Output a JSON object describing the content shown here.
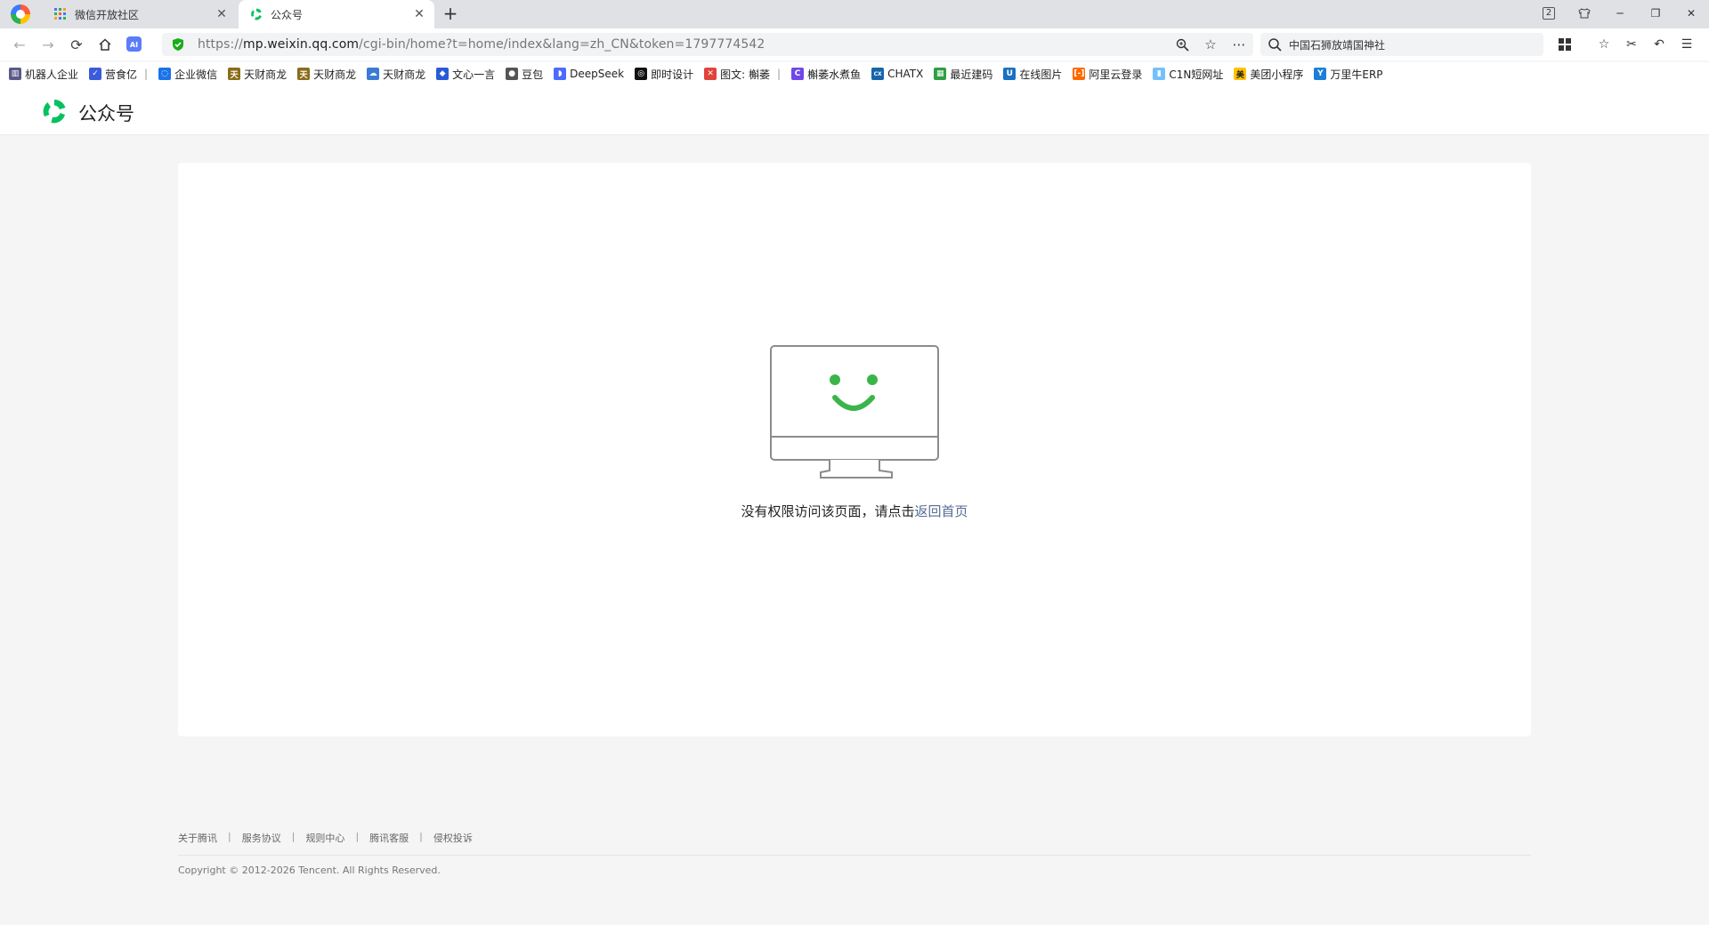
{
  "tabs": [
    {
      "title": "微信开放社区",
      "active": false
    },
    {
      "title": "公众号",
      "active": true
    }
  ],
  "window": {
    "tab_count_badge": "2"
  },
  "address_bar": {
    "scheme": "https://",
    "host": "mp.weixin.qq.com",
    "path": "/cgi-bin/home?t=home/index&lang=zh_CN&token=1797774542"
  },
  "search_box": {
    "value": "中国石狮放靖国神社"
  },
  "bookmarks": [
    {
      "label": "机器人企业",
      "icon": "robot-icon",
      "color": "#5a5a8a"
    },
    {
      "label": "营食亿",
      "icon": "shield-bookmark-icon",
      "color": "#3b5bdb",
      "separator": true
    },
    {
      "label": "企业微信",
      "icon": "wework-icon",
      "color": "#1a73e8"
    },
    {
      "label": "天财商龙",
      "icon": "tiancai-icon",
      "color": "#8a6d1a"
    },
    {
      "label": "天财商龙",
      "icon": "tiancai-icon",
      "color": "#8a6d1a"
    },
    {
      "label": "天财商龙",
      "icon": "cloud-icon",
      "color": "#3a7bd5"
    },
    {
      "label": "文心一言",
      "icon": "wenxin-icon",
      "color": "#2a5bd7"
    },
    {
      "label": "豆包",
      "icon": "doubao-icon",
      "color": "#555555"
    },
    {
      "label": "DeepSeek",
      "icon": "deepseek-icon",
      "color": "#4d6bfe"
    },
    {
      "label": "即时设计",
      "icon": "jsdesign-icon",
      "color": "#111111"
    },
    {
      "label": "图文: 槲萎",
      "icon": "tuwen-icon",
      "color": "#e0443b",
      "separator": true
    },
    {
      "label": "槲萎水煮鱼",
      "icon": "fish-icon",
      "color": "#7048e8"
    },
    {
      "label": "CHATX",
      "icon": "chatx-icon",
      "color": "#1864ab"
    },
    {
      "label": "最近建码",
      "icon": "grid-bookmark-icon",
      "color": "#2f9e44"
    },
    {
      "label": "在线图片",
      "icon": "u-icon",
      "color": "#1971c2"
    },
    {
      "label": "阿里云登录",
      "icon": "aliyun-icon",
      "color": "#ff6a00"
    },
    {
      "label": "C1N短网址",
      "icon": "c1n-icon",
      "color": "#74c0fc"
    },
    {
      "label": "美团小程序",
      "icon": "meituan-icon",
      "color": "#ffc300"
    },
    {
      "label": "万里牛ERP",
      "icon": "wanliniu-icon",
      "color": "#1c7ed6"
    }
  ],
  "site": {
    "name": "公众号",
    "brand_color": "#07c160"
  },
  "error": {
    "message": "没有权限访问该页面，请点击",
    "link_label": "返回首页"
  },
  "footer": {
    "links": [
      "关于腾讯",
      "服务协议",
      "规则中心",
      "腾讯客服",
      "侵权投诉"
    ],
    "copyright": "Copyright © 2012-2026 Tencent. All Rights Reserved."
  }
}
